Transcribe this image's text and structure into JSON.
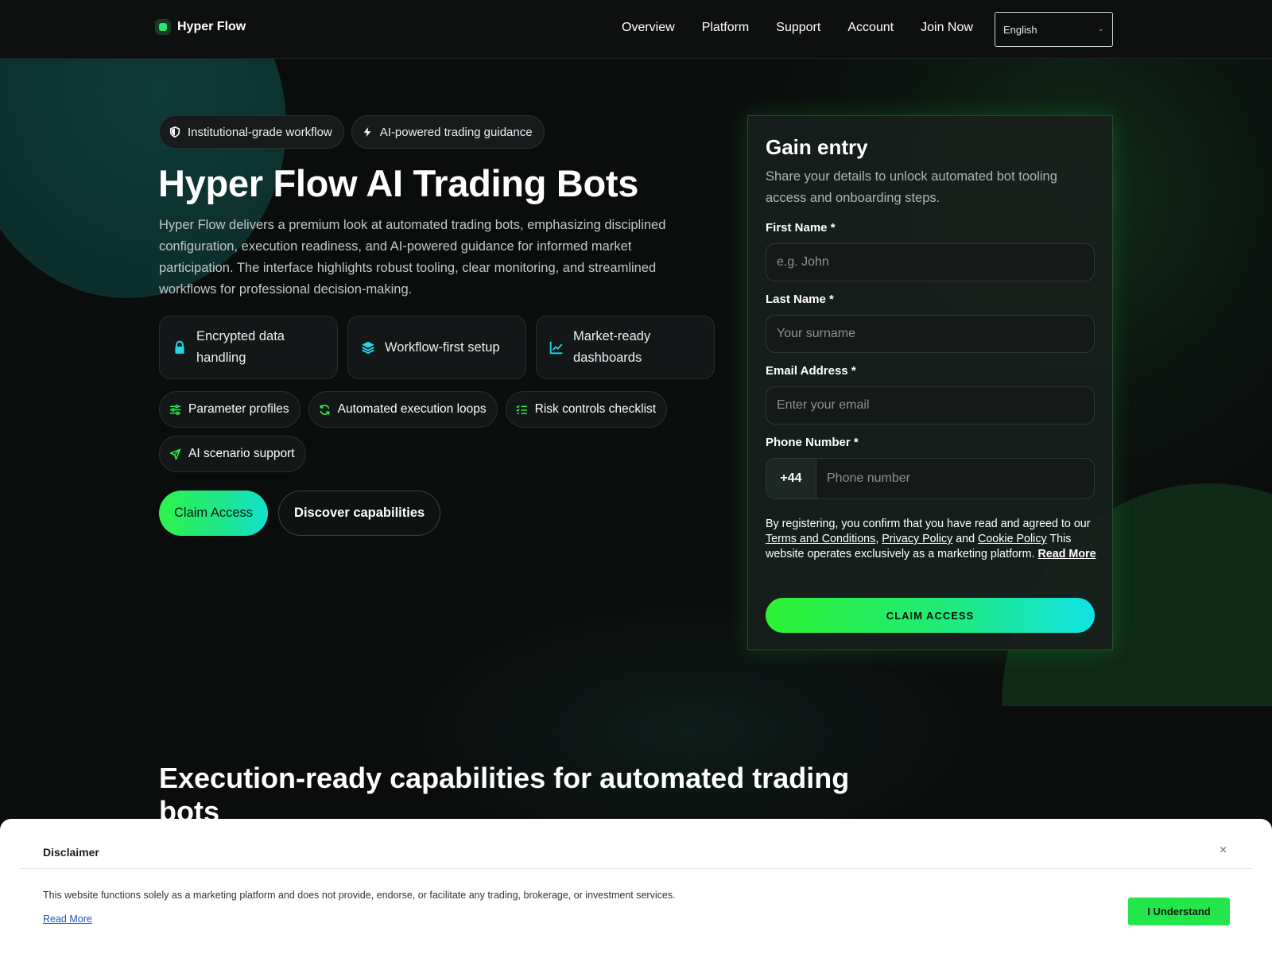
{
  "header": {
    "brand": "Hyper Flow",
    "nav": [
      "Overview",
      "Platform",
      "Support",
      "Account",
      "Join Now"
    ],
    "language": "English"
  },
  "hero": {
    "badges": [
      "Institutional-grade workflow",
      "AI-powered trading guidance"
    ],
    "title": "Hyper Flow AI Trading Bots",
    "description": "Hyper Flow delivers a premium look at automated trading bots, emphasizing disciplined configuration, execution readiness, and AI-powered guidance for informed market participation. The interface highlights robust tooling, clear monitoring, and streamlined workflows for professional decision-making.",
    "features": [
      "Encrypted data handling",
      "Workflow-first setup",
      "Market-ready dashboards"
    ],
    "chips": [
      "Parameter profiles",
      "Automated execution loops",
      "Risk controls checklist",
      "AI scenario support"
    ],
    "cta_primary": "Claim Access",
    "cta_secondary": "Discover capabilities"
  },
  "form": {
    "title": "Gain entry",
    "subtitle": "Share your details to unlock automated bot tooling access and onboarding steps.",
    "first_name_label": "First Name *",
    "first_name_placeholder": "e.g. John",
    "last_name_label": "Last Name *",
    "last_name_placeholder": "Your surname",
    "email_label": "Email Address *",
    "email_placeholder": "Enter your email",
    "phone_label": "Phone Number *",
    "phone_code": "+44",
    "phone_placeholder": "Phone number",
    "legal_prefix": "By registering, you confirm that you have read and agreed to our ",
    "terms_link": "Terms and Conditions",
    "comma": ", ",
    "privacy_link": "Privacy Policy",
    "and_text": " and ",
    "cookie_link": "Cookie Policy",
    "legal_suffix": " This website operates exclusively as a marketing platform. ",
    "read_more": "Read More",
    "submit": "CLAIM ACCESS"
  },
  "section": {
    "title": "Execution-ready capabilities for automated trading bots"
  },
  "disclaimer": {
    "title": "Disclaimer",
    "close": "×",
    "text": "This website functions solely as a marketing platform and does not provide, endorse, or facilitate any trading, brokerage, or investment services.",
    "read_more": "Read More",
    "button": "I Understand"
  },
  "colors": {
    "accent_green": "#2ef34a",
    "accent_cyan": "#12e2d0",
    "background": "#0b0d0d"
  },
  "icons": {
    "badges": [
      "shield-icon",
      "bolt-icon"
    ],
    "features": [
      "lock-icon",
      "layers-icon",
      "chart-line-icon"
    ],
    "chips": [
      "sliders-icon",
      "refresh-icon",
      "checklist-icon",
      "send-icon"
    ]
  }
}
